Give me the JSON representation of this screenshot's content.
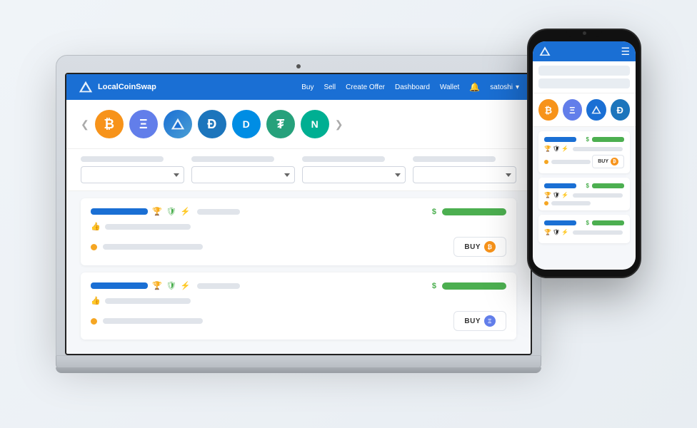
{
  "app": {
    "brand": "LocalCoinSwap",
    "nav": {
      "links": [
        "Buy",
        "Sell",
        "Create Offer",
        "Dashboard",
        "Wallet"
      ],
      "user": "satoshi",
      "bell": "🔔"
    }
  },
  "coins": [
    {
      "id": "btc",
      "symbol": "₿",
      "bg": "#f7931a",
      "label": "Bitcoin"
    },
    {
      "id": "eth",
      "symbol": "Ξ",
      "bg": "#627eea",
      "label": "Ethereum"
    },
    {
      "id": "lcs",
      "symbol": "▲",
      "bg": "#1a6fd4",
      "label": "LCS"
    },
    {
      "id": "dash",
      "symbol": "Đ",
      "bg": "#1c75bc",
      "label": "Dash"
    },
    {
      "id": "dash2",
      "symbol": "D",
      "bg": "#008de4",
      "label": "Dash2"
    },
    {
      "id": "usdt",
      "symbol": "₮",
      "bg": "#26a17b",
      "label": "USDT"
    },
    {
      "id": "neo",
      "symbol": "N",
      "bg": "#00af92",
      "label": "NEO"
    }
  ],
  "listings": [
    {
      "id": 1,
      "coinBg": "#f7931a",
      "coinSymbol": "₿"
    },
    {
      "id": 2,
      "coinBg": "#627eea",
      "coinSymbol": "Ξ"
    }
  ],
  "phone": {
    "coins": [
      {
        "bg": "#f7931a",
        "symbol": "₿"
      },
      {
        "bg": "#627eea",
        "symbol": "Ξ"
      },
      {
        "bg": "#1a6fd4",
        "symbol": "▲"
      },
      {
        "bg": "#1c75bc",
        "symbol": "Đ"
      }
    ]
  },
  "buttons": {
    "buy": "BUY",
    "prev": "❮",
    "next": "❯"
  }
}
